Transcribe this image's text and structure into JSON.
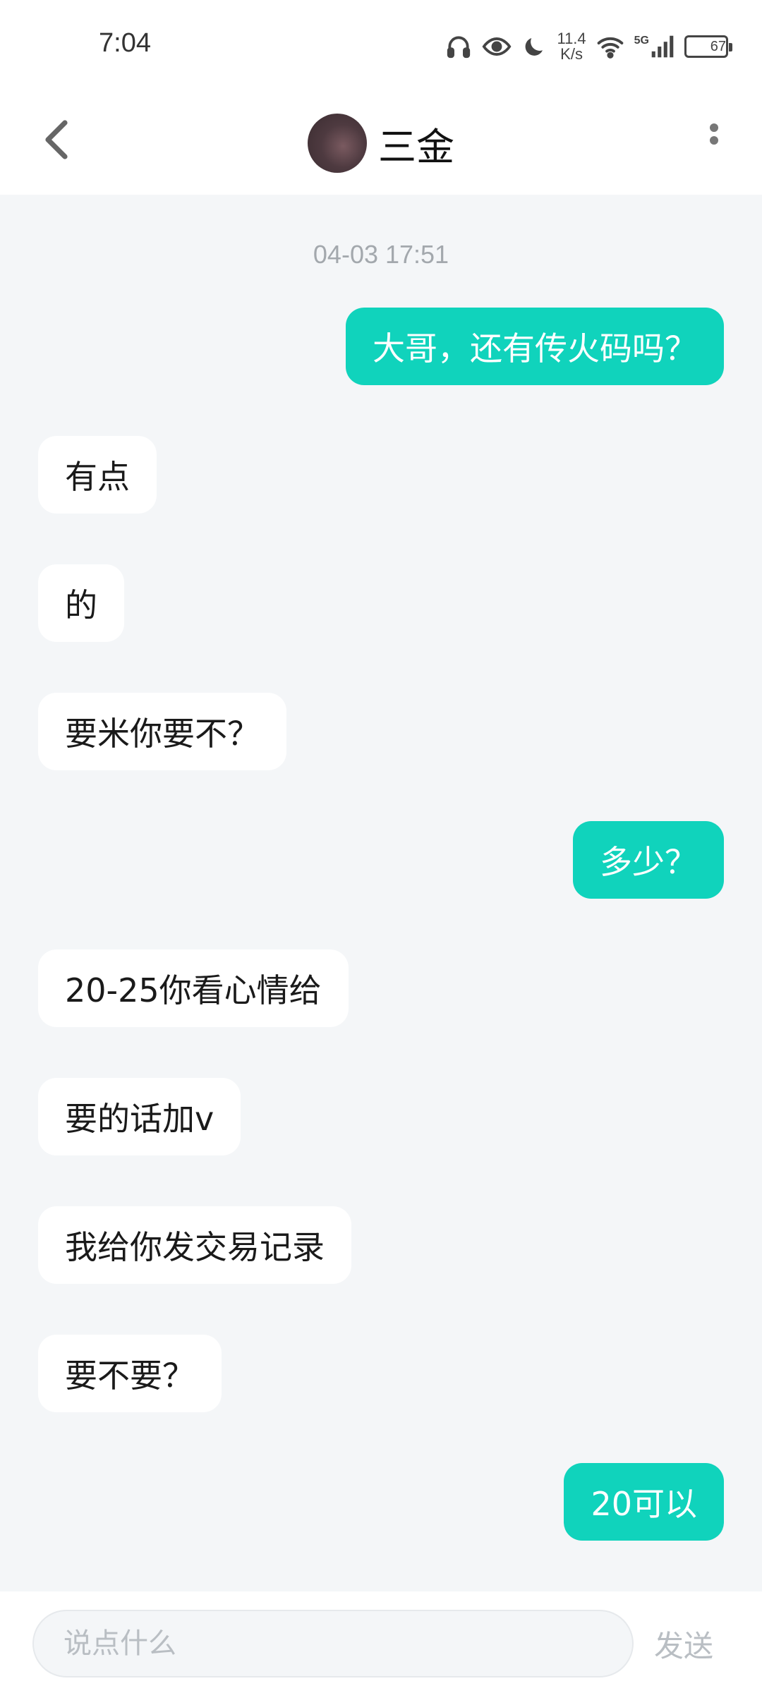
{
  "status_bar": {
    "time": "7:04",
    "net_speed_value": "11.4",
    "net_speed_unit": "K/s",
    "network_type": "5G",
    "battery_level": "67",
    "icons": [
      "headphones-icon",
      "eye-icon",
      "moon-icon",
      "wifi-icon",
      "signal-icon",
      "battery-icon"
    ]
  },
  "header": {
    "contact_name": "三金",
    "back_icon": "chevron-left-icon",
    "more_icon": "more-vertical-icon"
  },
  "chat": {
    "timestamp": "04-03 17:51",
    "messages": [
      {
        "direction": "out",
        "text": "大哥，还有传火码吗？"
      },
      {
        "direction": "in",
        "text": "有点"
      },
      {
        "direction": "in",
        "text": "的"
      },
      {
        "direction": "in",
        "text": "要米你要不？"
      },
      {
        "direction": "out",
        "text": "多少？"
      },
      {
        "direction": "in",
        "text": "20-25你看心情给"
      },
      {
        "direction": "in",
        "text": "要的话加v"
      },
      {
        "direction": "in",
        "text": "我给你发交易记录"
      },
      {
        "direction": "in",
        "text": "要不要？"
      },
      {
        "direction": "out",
        "text": "20可以"
      }
    ]
  },
  "input_bar": {
    "placeholder": "说点什么",
    "send_label": "发送"
  },
  "colors": {
    "accent": "#10d3bc",
    "chat_background": "#f4f6f8",
    "incoming_bubble": "#ffffff"
  }
}
